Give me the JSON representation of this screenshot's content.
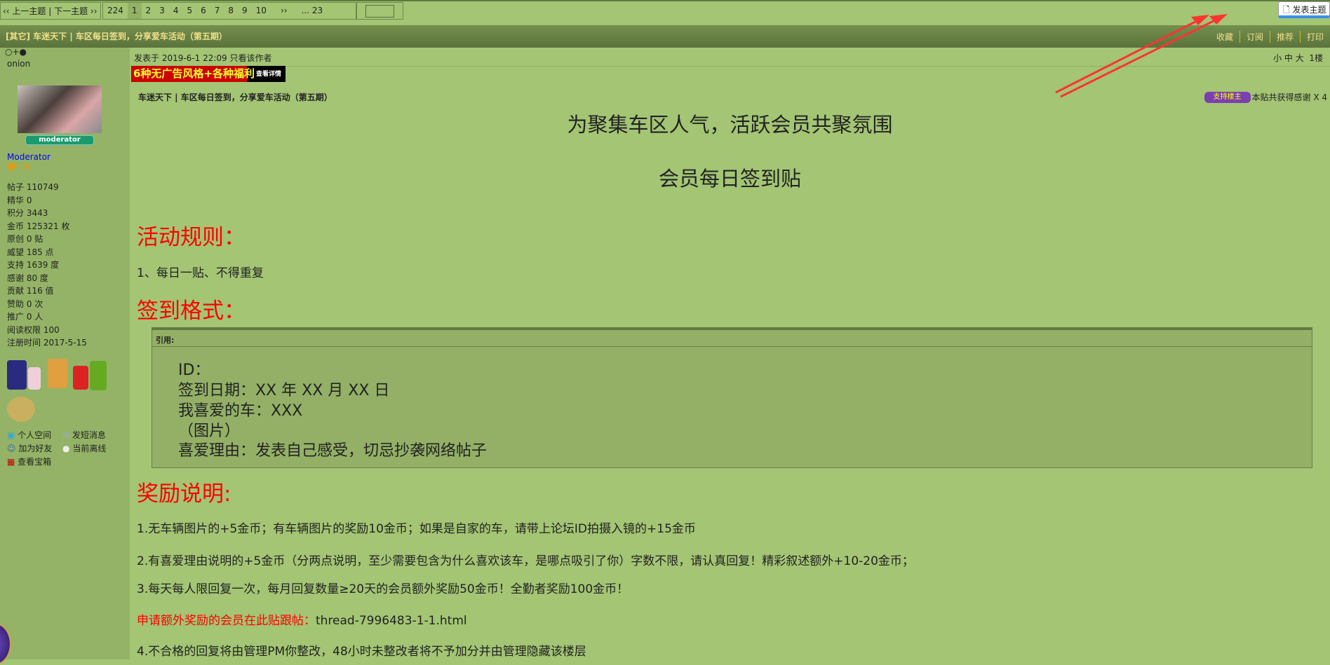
{
  "nav": {
    "prev_next": "‹‹ 上一主题 | 下一主题 ››",
    "pages": [
      "224",
      "1",
      "2",
      "3",
      "4",
      "5",
      "6",
      "7",
      "8",
      "9",
      "10",
      "››",
      "... 23"
    ],
    "current": "1",
    "new_post": "发表主题"
  },
  "title": "[其它] 车迷天下 | 车区每日签到，分享爱车活动（第五期）",
  "tools": [
    "收藏",
    "订阅",
    "推荐",
    "打印"
  ],
  "user": {
    "icons": "○+●",
    "name": "onion",
    "badge": "moderator",
    "group": "Moderator",
    "stats": [
      "帖子 110749",
      "精华 0",
      "积分 3443",
      "金币 125321 枚",
      "原创 0 贴",
      "威望 185 点",
      "支持 1639 度",
      "感谢 80 度",
      "贡献 116 值",
      "赞助 0 次",
      "推广 0 人",
      "阅读权限 100",
      "注册时间 2017-5-15"
    ],
    "links": [
      "个人空间",
      "发短消息",
      "加为好友",
      "当前离线",
      "查看宝箱"
    ]
  },
  "post": {
    "posted": "发表于 2019-6-1 22:09  只看该作者",
    "font_sizes": "小 中 大",
    "floor": "1楼",
    "ad": "6种无广告风格+各种福利",
    "ad_more": "查看详情",
    "subject": "车迷天下 | 车区每日签到，分享爱车活动（第五期）",
    "thanks_badge": "支持楼主",
    "thanks": "本贴共获得感谢 X 4",
    "heading1": "为聚集车区人气，活跃会员共聚氛围",
    "heading2": "会员每日签到贴",
    "rules_title": "活动规则：",
    "rule1": "1、每日一贴、不得重复",
    "format_title": "签到格式：",
    "quote_label": "引用:",
    "quote_lines": [
      "ID：",
      "签到日期：XX 年 XX 月 XX 日",
      "我喜爱的车：XXX",
      "（图片）",
      "喜爱理由：发表自己感受，切忌抄袭网络帖子"
    ],
    "reward_title": "奖励说明:",
    "reward1": "1.无车辆图片的+5金币；有车辆图片的奖励10金币；如果是自家的车，请带上论坛ID拍摄入镜的+15金币",
    "reward2": "2.有喜爱理由说明的+5金币（分两点说明，至少需要包含为什么喜欢该车，是哪点吸引了你）字数不限，请认真回复！精彩叙述额外+10-20金币；",
    "reward3": "3.每天每人限回复一次，每月回复数量≥20天的会员额外奖励50金币！全勤者奖励100金币！",
    "apply_red": "申请额外奖励的会员在此贴跟帖：",
    "apply_link": "thread-7996483-1-1.html",
    "reward4": "4.不合格的回复将由管理PM你整改，48小时未整改者将不予加分并由管理隐藏该楼层"
  }
}
